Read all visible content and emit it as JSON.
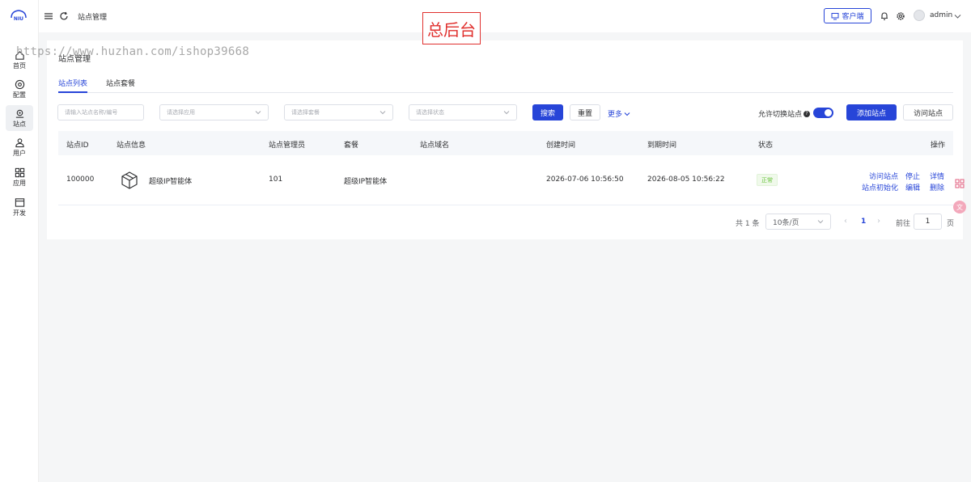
{
  "sidebar": {
    "logo_text": "NIU",
    "items": [
      {
        "label": "首页",
        "icon": "home-icon"
      },
      {
        "label": "配置",
        "icon": "settings-circle-icon"
      },
      {
        "label": "站点",
        "icon": "location-icon"
      },
      {
        "label": "用户",
        "icon": "user-icon"
      },
      {
        "label": "应用",
        "icon": "grid-icon"
      },
      {
        "label": "开发",
        "icon": "window-icon"
      }
    ]
  },
  "header": {
    "breadcrumb": "站点管理",
    "client_button": "客户端",
    "username": "admin"
  },
  "stamp": "总后台",
  "watermark": "https://www.huzhan.com/ishop39668",
  "page": {
    "title": "站点管理",
    "tabs": [
      "站点列表",
      "站点套餐"
    ]
  },
  "filters": {
    "name_placeholder": "请输入站点名称/编号",
    "app_placeholder": "请选择应用",
    "package_placeholder": "请选择套餐",
    "status_placeholder": "请选择状态",
    "search_button": "搜索",
    "reset_button": "重置",
    "more_link": "更多",
    "switch_label": "允许切换站点",
    "switch_help": "?",
    "switch_on": true,
    "add_button": "添加站点",
    "visit_button": "访问站点"
  },
  "table": {
    "headers": [
      "站点ID",
      "站点信息",
      "站点管理员",
      "套餐",
      "站点域名",
      "创建时间",
      "到期时间",
      "状态",
      "操作"
    ],
    "rows": [
      {
        "id": "100000",
        "name": "超级IP智能体",
        "admin": "101",
        "package": "超级IP智能体",
        "domain": "",
        "created": "2026-07-06 10:56:50",
        "expires": "2026-08-05 10:56:22",
        "status": "正常",
        "actions": {
          "visit": "访问站点",
          "stop": "停止",
          "detail": "详情",
          "init": "站点初始化",
          "edit": "编辑",
          "delete": "删除"
        }
      }
    ]
  },
  "pagination": {
    "total": "共 1 条",
    "page_size": "10条/页",
    "current": "1",
    "goto_label": "前往",
    "goto_value": "1",
    "page_suffix": "页"
  },
  "colors": {
    "primary": "#2745d8",
    "success": "#67c23a",
    "stamp": "#e0302e"
  }
}
